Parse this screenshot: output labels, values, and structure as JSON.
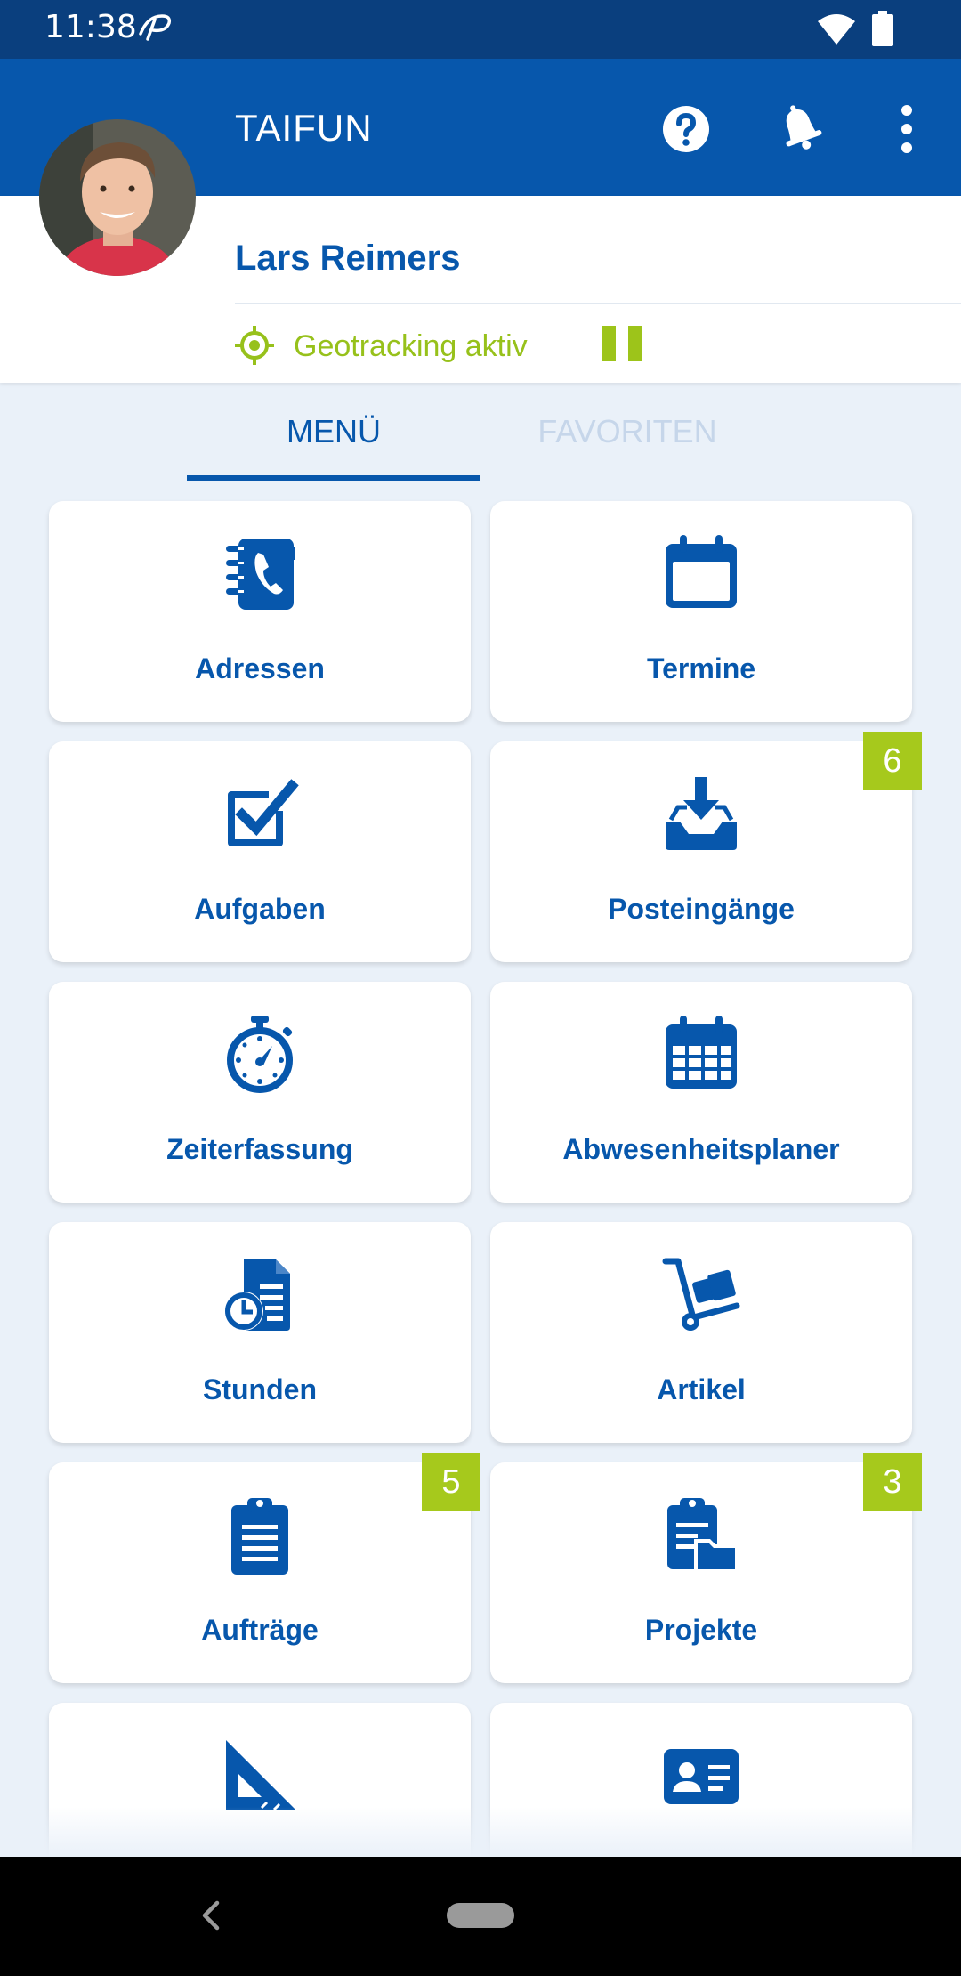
{
  "status_bar": {
    "time": "11:38",
    "icons": [
      "app-notification-icon",
      "wifi-icon",
      "battery-icon"
    ]
  },
  "app_bar": {
    "title": "TAIFUN",
    "actions": [
      "help-icon",
      "bell-icon",
      "more-vert-icon"
    ]
  },
  "profile": {
    "name": "Lars Reimers",
    "geotracking_label": "Geotracking aktiv",
    "geotracking_active": true
  },
  "tabs": [
    {
      "label": "MENÜ",
      "active": true
    },
    {
      "label": "FAVORITEN",
      "active": false
    }
  ],
  "tiles": [
    {
      "label": "Adressen",
      "icon": "address-book-icon"
    },
    {
      "label": "Termine",
      "icon": "calendar-icon"
    },
    {
      "label": "Aufgaben",
      "icon": "checkbox-icon"
    },
    {
      "label": "Posteingänge",
      "icon": "inbox-download-icon",
      "badge": "6"
    },
    {
      "label": "Zeiterfassung",
      "icon": "stopwatch-icon"
    },
    {
      "label": "Abwesenheitsplaner",
      "icon": "calendar-grid-icon"
    },
    {
      "label": "Stunden",
      "icon": "timesheet-icon"
    },
    {
      "label": "Artikel",
      "icon": "hand-truck-icon"
    },
    {
      "label": "Aufträge",
      "icon": "clipboard-icon",
      "badge": "5"
    },
    {
      "label": "Projekte",
      "icon": "clipboard-folder-icon",
      "badge": "3"
    },
    {
      "label": "",
      "icon": "set-square-icon"
    },
    {
      "label": "",
      "icon": "id-card-icon"
    }
  ],
  "colors": {
    "primary": "#0757ac",
    "status_bar": "#0a3f7e",
    "accent_green": "#a6c91c",
    "background": "#eaf1f9",
    "tab_inactive": "#c6d6ea"
  }
}
